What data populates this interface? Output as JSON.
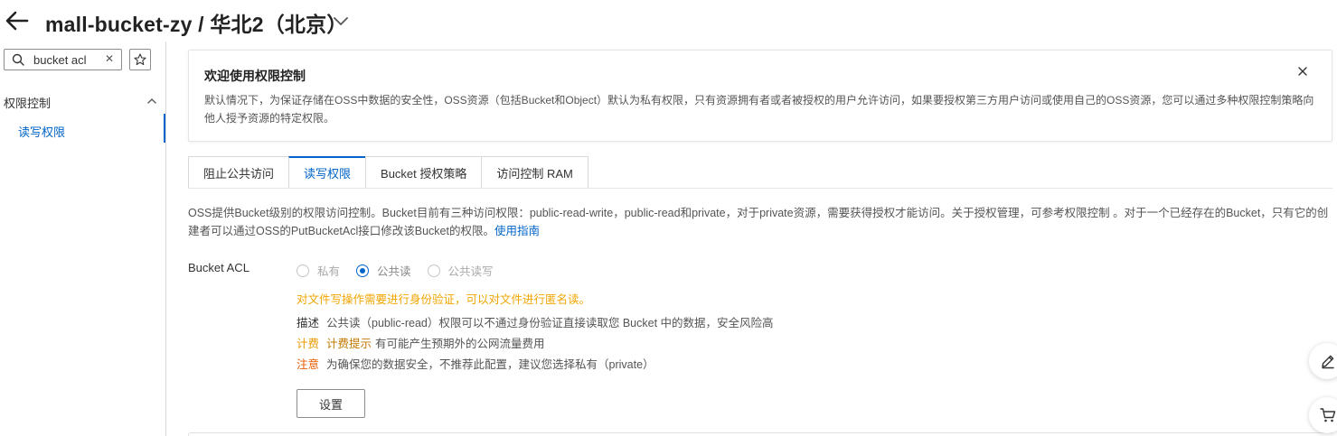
{
  "header": {
    "title": "mall-bucket-zy / 华北2（北京）"
  },
  "sidebar": {
    "search_value": "bucket acl",
    "group_label": "权限控制",
    "items": [
      {
        "label": "读写权限"
      }
    ]
  },
  "notice": {
    "title": "欢迎使用权限控制",
    "text": "默认情况下，为保证存储在OSS中数据的安全性，OSS资源（包括Bucket和Object）默认为私有权限，只有资源拥有者或者被授权的用户允许访问，如果要授权第三方用户访问或使用自己的OSS资源，您可以通过多种权限控制策略向他人授予资源的特定权限。"
  },
  "tabs": [
    {
      "label": "阻止公共访问"
    },
    {
      "label": "读写权限"
    },
    {
      "label": "Bucket 授权策略"
    },
    {
      "label": "访问控制 RAM"
    }
  ],
  "description": {
    "text": "OSS提供Bucket级别的权限访问控制。Bucket目前有三种访问权限：public-read-write，public-read和private，对于private资源，需要获得授权才能访问。关于授权管理，可参考权限控制 。对于一个已经存在的Bucket，只有它的创建者可以通过OSS的PutBucketAcl接口修改该Bucket的权限。",
    "link": "使用指南"
  },
  "acl": {
    "label": "Bucket ACL",
    "options": [
      {
        "label": "私有"
      },
      {
        "label": "公共读"
      },
      {
        "label": "公共读写"
      }
    ],
    "selected": "公共读",
    "warning": "对文件写操作需要进行身份验证，可以对文件进行匿名读。",
    "desc_key": "描述",
    "desc_text": "公共读（public-read）权限可以不通过身份验证直接读取您 Bucket 中的数据，安全风险高",
    "fee_key": "计费",
    "fee_tip": "计费提示",
    "fee_text": "有可能产生预期外的公网流量费用",
    "note_key": "注意",
    "note_text": "为确保您的数据安全，不推荐此配置，建议您选择私有（private）",
    "button": "设置"
  },
  "colors": {
    "accent": "#0064c8",
    "warning": "#f0a500",
    "fee": "#e79b00",
    "note": "#ea5b00"
  },
  "icons": [
    "back-arrow-icon",
    "chevron-down-icon",
    "search-icon",
    "clear-icon",
    "star-icon",
    "chevron-up-icon",
    "close-icon",
    "edit-icon",
    "cart-icon"
  ]
}
